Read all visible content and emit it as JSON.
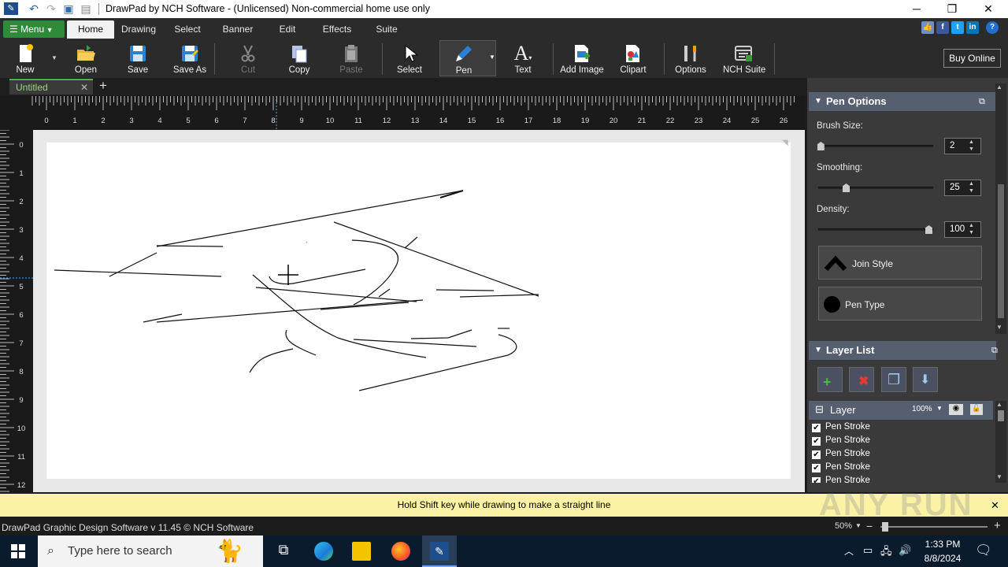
{
  "window": {
    "title": "DrawPad by NCH Software - (Unlicensed) Non-commercial home use only",
    "minimize": "─",
    "restore": "❐",
    "close": "✕"
  },
  "menu": {
    "menu_label": "Menu",
    "tabs": [
      "Home",
      "Drawing",
      "Select",
      "Banner",
      "Edit",
      "Effects",
      "Suite"
    ],
    "help": "?"
  },
  "toolbar": {
    "new": "New",
    "open": "Open",
    "save": "Save",
    "save_as": "Save As",
    "cut": "Cut",
    "copy": "Copy",
    "paste": "Paste",
    "select": "Select",
    "pen": "Pen",
    "text": "Text",
    "add_image": "Add Image",
    "clipart": "Clipart",
    "options": "Options",
    "nch_suite": "NCH Suite",
    "buy_online": "Buy Online"
  },
  "document": {
    "tab_name": "Untitled",
    "add_tab": "+",
    "close_tab": "✕"
  },
  "ruler": {
    "h_ticks": [
      "0",
      "1",
      "2",
      "3",
      "4",
      "5",
      "6",
      "7",
      "8",
      "9",
      "10",
      "11",
      "12",
      "13",
      "14",
      "15",
      "16",
      "17",
      "18",
      "19",
      "20",
      "21",
      "22",
      "23",
      "24",
      "25",
      "26"
    ],
    "v_ticks": [
      "0",
      "1",
      "2",
      "3",
      "4",
      "5",
      "6",
      "7",
      "8",
      "9",
      "10",
      "11",
      "12"
    ]
  },
  "pen_options": {
    "title": "Pen Options",
    "brush_size_label": "Brush Size:",
    "brush_size": "2",
    "brush_level": 0.02,
    "smoothing_label": "Smoothing:",
    "smoothing": "25",
    "smoothing_level": 0.25,
    "density_label": "Density:",
    "density": "100",
    "density_level": 1.0,
    "join_style": "Join Style",
    "pen_type": "Pen Type"
  },
  "layer_list": {
    "title": "Layer List",
    "layer_name": "Layer",
    "opacity": "100%",
    "items": [
      "Pen Stroke",
      "Pen Stroke",
      "Pen Stroke",
      "Pen Stroke",
      "Pen Stroke"
    ]
  },
  "hint": "Hold Shift key while drawing to make a straight line",
  "status": {
    "left": "DrawPad Graphic Design Software v 11.45 © NCH Software",
    "zoom": "50%"
  },
  "taskbar": {
    "search_placeholder": "Type here to search",
    "time": "1:33 PM",
    "date": "8/8/2024"
  },
  "watermark": "ANY RUN"
}
